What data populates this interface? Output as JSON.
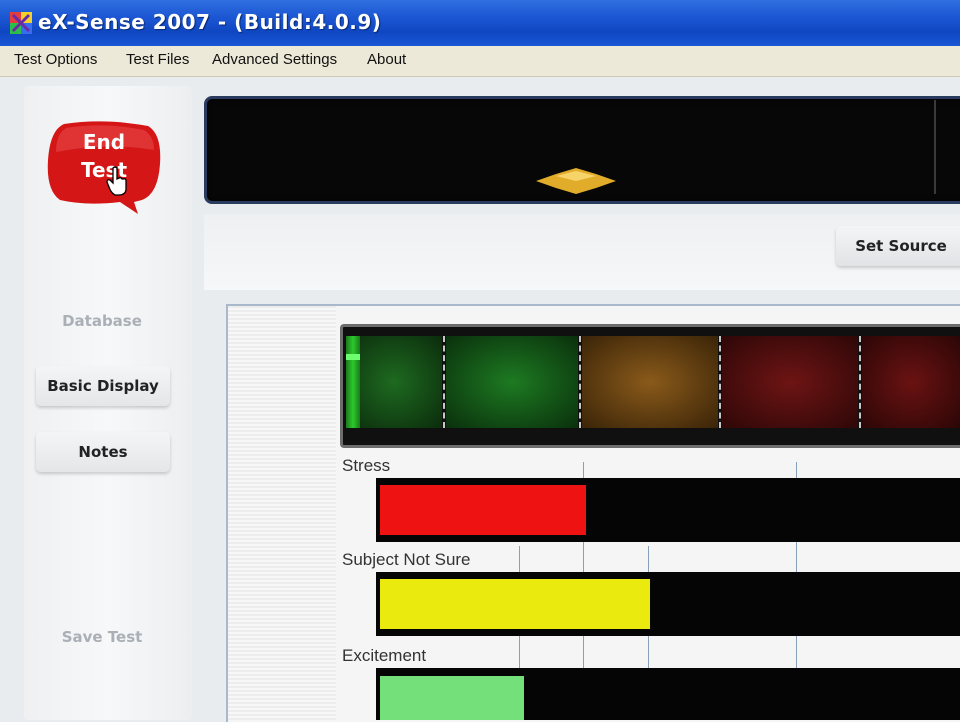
{
  "window": {
    "title": "eX-Sense 2007 - (Build:4.0.9)"
  },
  "menu": {
    "items": [
      "Test Options",
      "Test Files",
      "Advanced Settings",
      "About"
    ]
  },
  "sidebar": {
    "end_test_label_line1": "End",
    "end_test_label_line2": "Test",
    "database_label": "Database",
    "basic_display_label": "Basic Display",
    "notes_label": "Notes",
    "save_test_label": "Save Test"
  },
  "source": {
    "set_source_label": "Set Source"
  },
  "meter": {
    "segment_colors": [
      "#0f3a10",
      "#0e4a12",
      "#5b3a0f",
      "#4a0c0c",
      "#4a0a0a"
    ],
    "indicator_color": "#2cc92c"
  },
  "bars": [
    {
      "label": "Stress",
      "color": "#ef1212"
    },
    {
      "label": "Subject Not Sure",
      "color": "#eaea0e"
    },
    {
      "label": "Excitement",
      "color": "#74e07a"
    }
  ],
  "icons": {
    "app_icon": "app-logo-icon",
    "cursor": "hand-cursor-icon",
    "marker": "diamond-marker-icon"
  }
}
